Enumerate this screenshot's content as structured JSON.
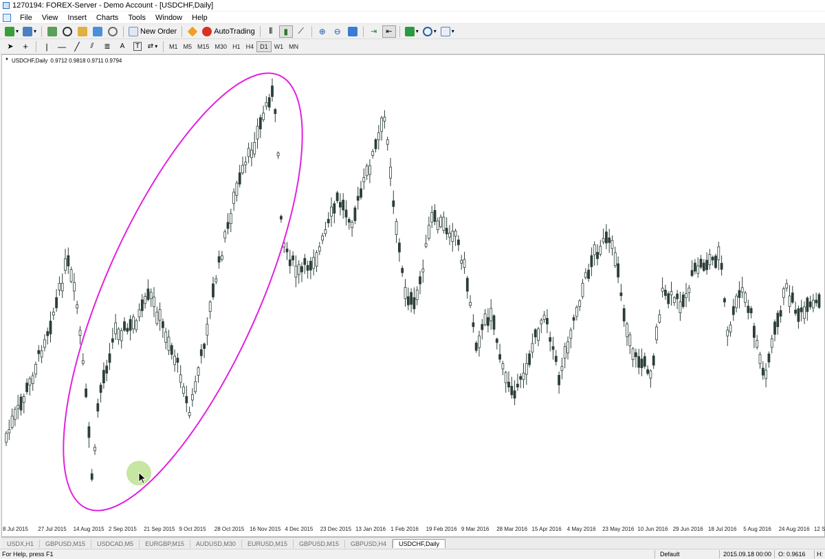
{
  "window": {
    "title": "1270194: FOREX-Server - Demo Account - [USDCHF,Daily]"
  },
  "menu": [
    "File",
    "View",
    "Insert",
    "Charts",
    "Tools",
    "Window",
    "Help"
  ],
  "toolbar": {
    "new_order_label": "New Order",
    "autotrading_label": "AutoTrading",
    "timeframes": [
      "M1",
      "M5",
      "M15",
      "M30",
      "H1",
      "H4",
      "D1",
      "W1",
      "MN"
    ],
    "active_timeframe": "D1"
  },
  "chart": {
    "symbol_label": "USDCHF,Daily",
    "ohlc": "0.9712 0.9818 0.9711 0.9794",
    "annotation_color": "#e21fe0",
    "x_ticks": [
      "8 Jul 2015",
      "27 Jul 2015",
      "14 Aug 2015",
      "2 Sep 2015",
      "21 Sep 2015",
      "9 Oct 2015",
      "28 Oct 2015",
      "16 Nov 2015",
      "4 Dec 2015",
      "23 Dec 2015",
      "13 Jan 2016",
      "1 Feb 2016",
      "19 Feb 2016",
      "9 Mar 2016",
      "28 Mar 2016",
      "15 Apr 2016",
      "4 May 2016",
      "23 May 2016",
      "10 Jun 2016",
      "29 Jun 2016",
      "18 Jul 2016",
      "5 Aug 2016",
      "24 Aug 2016",
      "12 Sep 2016"
    ],
    "candle_color": "#2c3e3a"
  },
  "tabs": {
    "items": [
      "USDX,H1",
      "GBPUSD,M15",
      "USDCAD,M5",
      "EURGBP,M15",
      "AUDUSD,M30",
      "EURUSD,M15",
      "GBPUSD,M15",
      "GBPUSD,H4",
      "USDCHF,Daily"
    ],
    "active_index": 8
  },
  "status": {
    "help": "For Help, press F1",
    "profile": "Default",
    "datetime": "2015.09.18 00:00",
    "open": "O: 0.9616",
    "high": "H:"
  }
}
